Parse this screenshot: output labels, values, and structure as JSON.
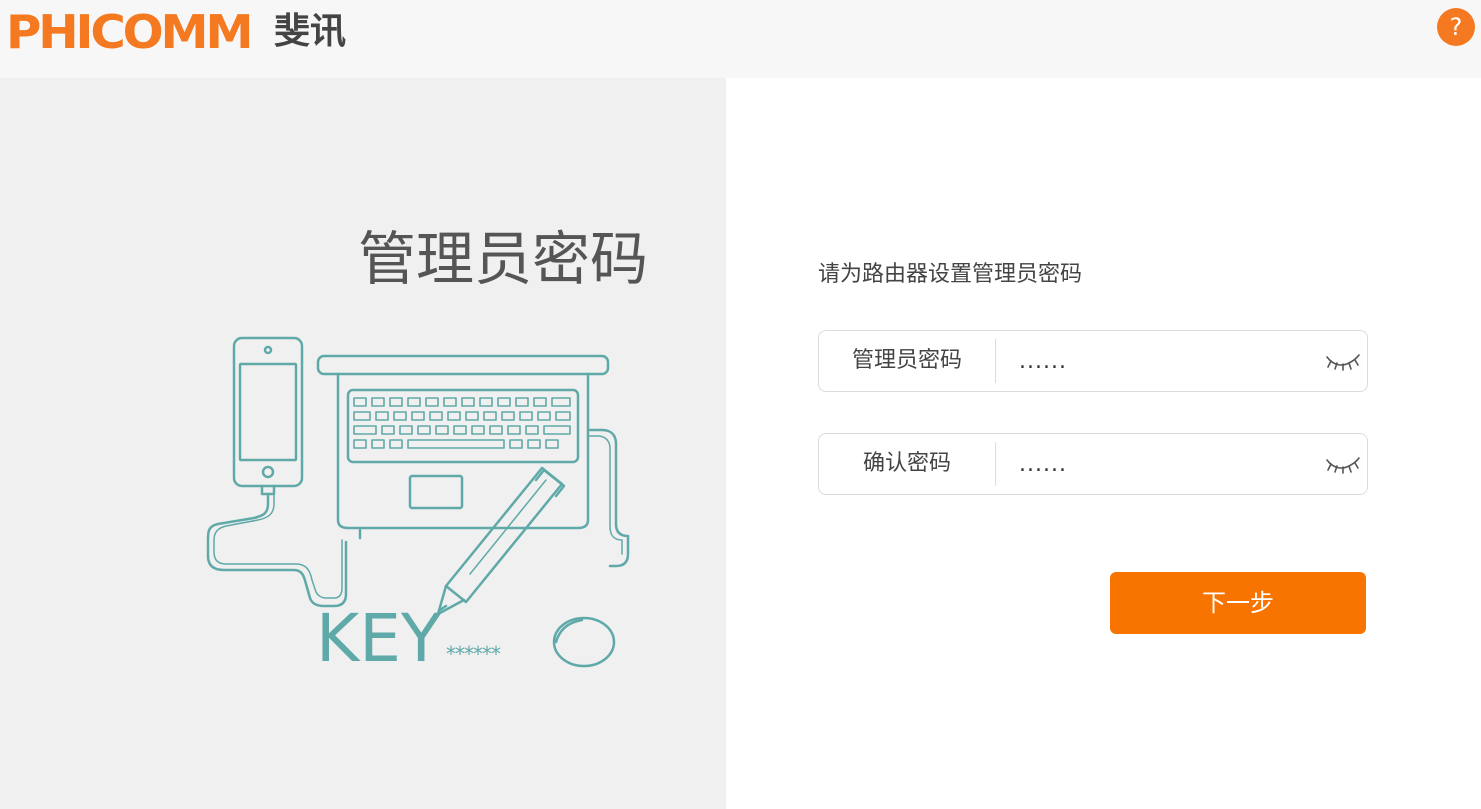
{
  "header": {
    "logo_brand": "PHICOMM",
    "logo_cn": "斐讯",
    "help_label": "?"
  },
  "left": {
    "title": "管理员密码",
    "key_text": "KEY",
    "key_stars": "******"
  },
  "form": {
    "heading": "请为路由器设置管理员密码",
    "password": {
      "label": "管理员密码",
      "value": "......"
    },
    "confirm": {
      "label": "确认密码",
      "value": "......"
    },
    "next_label": "下一步"
  },
  "colors": {
    "brand_orange": "#f47920",
    "button_orange": "#f87400",
    "illustration_teal": "#5fa9a8"
  }
}
